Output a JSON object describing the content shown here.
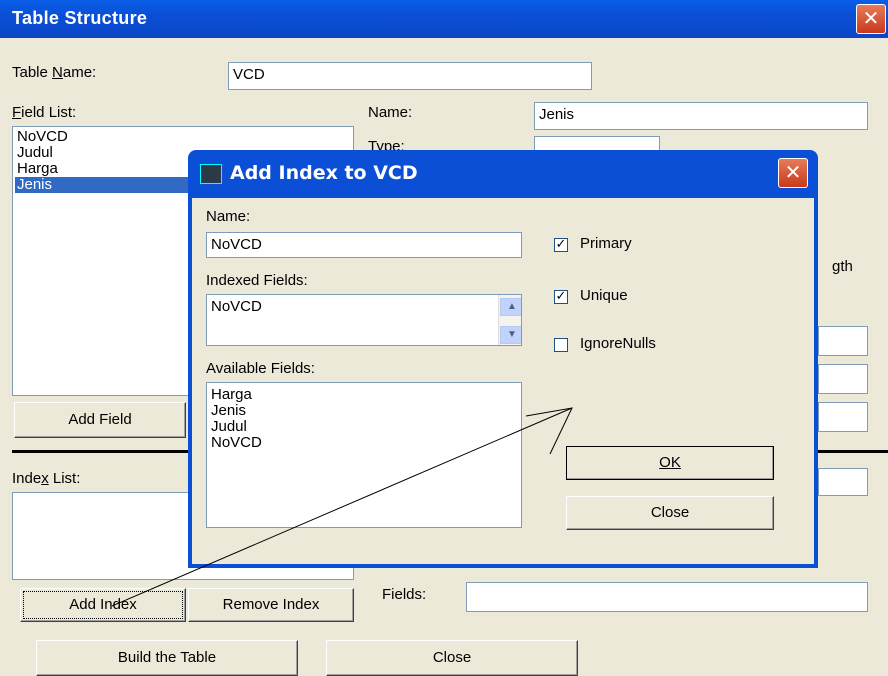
{
  "window": {
    "title": "Table Structure"
  },
  "table_name": {
    "label": "Table Name:",
    "value": "VCD"
  },
  "field_list": {
    "label": "Field List:",
    "items": [
      "NoVCD",
      "Judul",
      "Harga",
      "Jenis"
    ],
    "selected": "Jenis"
  },
  "field_props": {
    "name_label": "Name:",
    "name_value": "Jenis",
    "type_label": "Type:",
    "partial_right_1": "gth"
  },
  "buttons": {
    "add_field": "Add Field",
    "add_index": "Add Index",
    "remove_index": "Remove Index",
    "build_table": "Build the Table",
    "close": "Close"
  },
  "index_list": {
    "label": "Index List:"
  },
  "fields": {
    "label": "Fields:",
    "value": ""
  },
  "dialog": {
    "title": "Add Index to VCD",
    "name_label": "Name:",
    "name_value": "NoVCD",
    "indexed_label": "Indexed Fields:",
    "indexed_items": [
      "NoVCD"
    ],
    "available_label": "Available Fields:",
    "available_items": [
      "Harga",
      "Jenis",
      "Judul",
      "NoVCD"
    ],
    "primary_label": "Primary",
    "primary_checked": true,
    "unique_label": "Unique",
    "unique_checked": true,
    "ignorenulls_label": "IgnoreNulls",
    "ignorenulls_checked": false,
    "ok_label": "OK",
    "close_label": "Close"
  },
  "colors": {
    "titlebar": "#0a4fd6",
    "selection": "#316ac5",
    "face": "#ece9d8"
  },
  "icons": [
    "close-icon",
    "app-icon",
    "check-icon"
  ]
}
